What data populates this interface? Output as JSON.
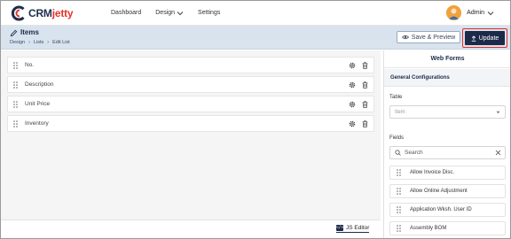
{
  "brand": {
    "name_dark": "CRM",
    "name_accent": "jetty"
  },
  "nav": [
    {
      "label": "Dashboard",
      "has_dropdown": false
    },
    {
      "label": "Design",
      "has_dropdown": true
    },
    {
      "label": "Settings",
      "has_dropdown": false
    }
  ],
  "user": {
    "name": "Admin"
  },
  "header": {
    "title": "Items",
    "breadcrumb": [
      "Design",
      "Lists",
      "Edit List"
    ],
    "preview_label": "Save & Preview",
    "update_label": "Update"
  },
  "list_fields": [
    {
      "label": "No."
    },
    {
      "label": "Description"
    },
    {
      "label": "Unit Price"
    },
    {
      "label": "Inventory"
    }
  ],
  "footer": {
    "js_editor_label": "JS Editor",
    "js_editor_icon": "</>"
  },
  "panel": {
    "title": "Web Forms",
    "section": "General Configurations",
    "table_label": "Table",
    "table_placeholder": "Item",
    "fields_label": "Fields",
    "search_placeholder": "Search",
    "fields": [
      {
        "label": "Allow Invoice Disc."
      },
      {
        "label": "Allow Online Adjustment"
      },
      {
        "label": "Application Wksh. User ID"
      },
      {
        "label": "Assembly BOM"
      }
    ]
  },
  "colors": {
    "brand_dark": "#1f2d4d",
    "brand_accent": "#e2352a",
    "header_band": "#d8e3ee",
    "primary_button": "#1c2a4a",
    "highlight_border": "#e12b2b"
  }
}
